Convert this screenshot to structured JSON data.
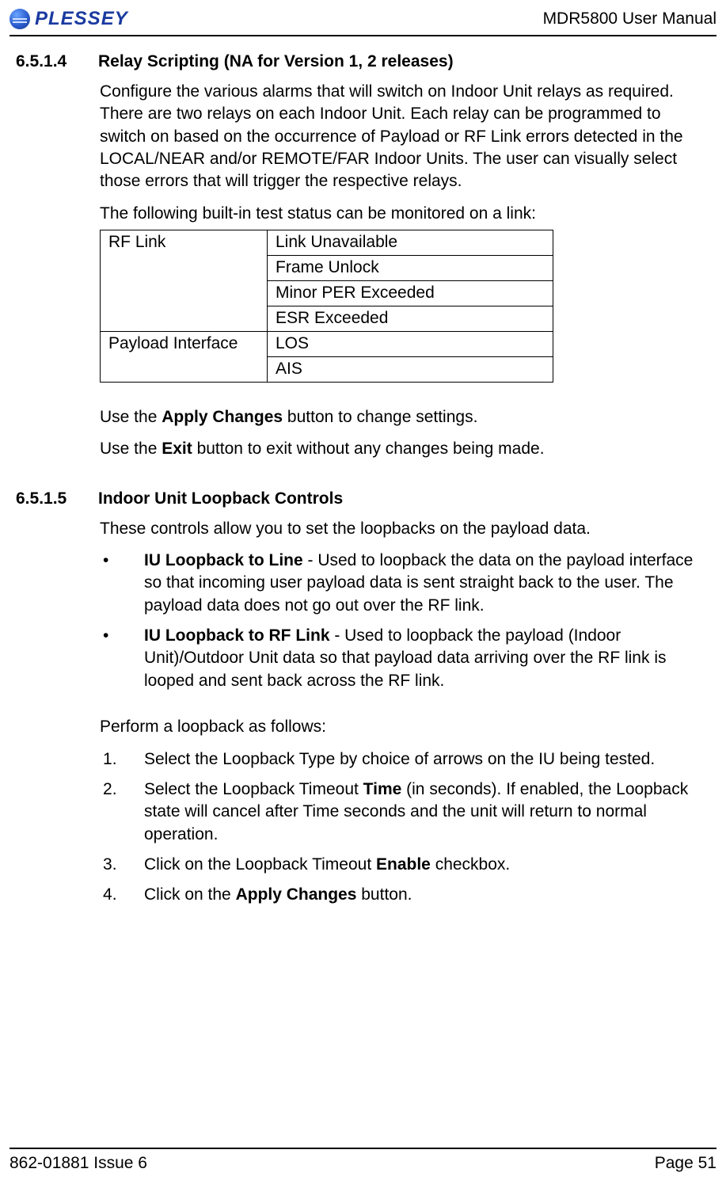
{
  "header": {
    "brand_name": "PLESSEY",
    "doc_title": "MDR5800 User Manual"
  },
  "section1": {
    "number": "6.5.1.4",
    "title": "Relay Scripting (NA for Version 1, 2 releases)",
    "para1": "Configure the various alarms that will switch on Indoor Unit relays as required.  There are two relays on each Indoor Unit.  Each relay can be programmed to switch on based on the occurrence of Payload or RF Link errors detected in the LOCAL/NEAR and/or REMOTE/FAR Indoor Units.  The user can visually select those errors that will trigger the respective relays.",
    "para2": "The following built-in test status can be monitored on a link:",
    "table": {
      "rows": [
        {
          "category": "RF Link",
          "value": "Link Unavailable"
        },
        {
          "category": "",
          "value": "Frame Unlock"
        },
        {
          "category": "",
          "value": "Minor PER Exceeded"
        },
        {
          "category": "",
          "value": "ESR Exceeded"
        },
        {
          "category": "Payload Interface",
          "value": "LOS"
        },
        {
          "category": "",
          "value": "AIS"
        }
      ]
    },
    "para3_pre": "Use the ",
    "para3_bold": "Apply Changes",
    "para3_post": " button to change settings.",
    "para4_pre": "Use the ",
    "para4_bold": "Exit",
    "para4_post": " button to exit without any changes being made."
  },
  "section2": {
    "number": "6.5.1.5",
    "title": "Indoor Unit Loopback Controls",
    "intro": "These controls allow you to set the loopbacks on the payload data.",
    "bullets": [
      {
        "lead": "IU Loopback to Line",
        "rest": " - Used to loopback the data on the payload interface so that incoming user payload data is sent straight back to the user.  The payload data does not go out over the RF link."
      },
      {
        "lead": "IU Loopback to RF Link",
        "rest": " - Used to loopback the payload (Indoor Unit)/Outdoor Unit data so that payload data arriving over the RF link is looped and sent back across the RF link."
      }
    ],
    "steps_intro": "Perform a loopback as follows:",
    "steps": [
      {
        "segments": [
          {
            "t": "Select the Loopback Type by choice of arrows on the IU being tested."
          }
        ]
      },
      {
        "segments": [
          {
            "t": "Select the Loopback Timeout "
          },
          {
            "t": "Time",
            "b": true
          },
          {
            "t": " (in seconds).  If enabled, the Loopback state will cancel after Time seconds and the unit will return to normal operation."
          }
        ]
      },
      {
        "segments": [
          {
            "t": "Click on the Loopback Timeout "
          },
          {
            "t": "Enable",
            "b": true
          },
          {
            "t": " checkbox."
          }
        ]
      },
      {
        "segments": [
          {
            "t": "Click on the "
          },
          {
            "t": "Apply Changes",
            "b": true
          },
          {
            "t": " button."
          }
        ]
      }
    ]
  },
  "footer": {
    "left": "862-01881 Issue 6",
    "right": "Page 51"
  }
}
